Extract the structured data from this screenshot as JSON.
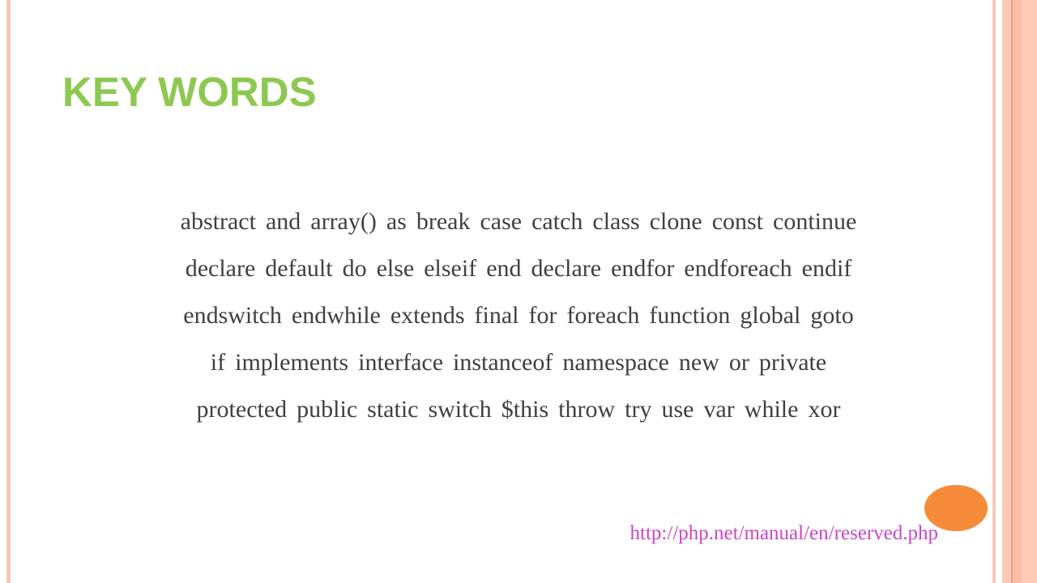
{
  "slide": {
    "title": "KEY WORDS",
    "keyword_lines": [
      [
        "abstract",
        "and",
        "array()",
        "as",
        "break",
        "case",
        "catch",
        "class",
        "clone",
        "const",
        "continue"
      ],
      [
        "declare",
        "default",
        "do",
        "else",
        "elseif",
        "end",
        "declare",
        "endfor",
        "endforeach",
        "endif"
      ],
      [
        "endswitch",
        "endwhile",
        "extends",
        "final",
        "for",
        "foreach",
        "function",
        "global",
        "goto"
      ],
      [
        "if",
        "implements",
        "interface",
        "instanceof",
        "namespace",
        "new",
        "or",
        "private"
      ],
      [
        "protected",
        "public",
        "static",
        "switch",
        "$this",
        "throw",
        "try",
        "use",
        "var",
        "while",
        "xor"
      ]
    ],
    "reference_link": "http://php.net/manual/en/reserved.php"
  },
  "colors": {
    "title": "#8DC851",
    "body_text": "#404040",
    "link": "#CC44CC",
    "accent_oval": "#F68B3A",
    "border_stripes": "#FEC9B6"
  }
}
